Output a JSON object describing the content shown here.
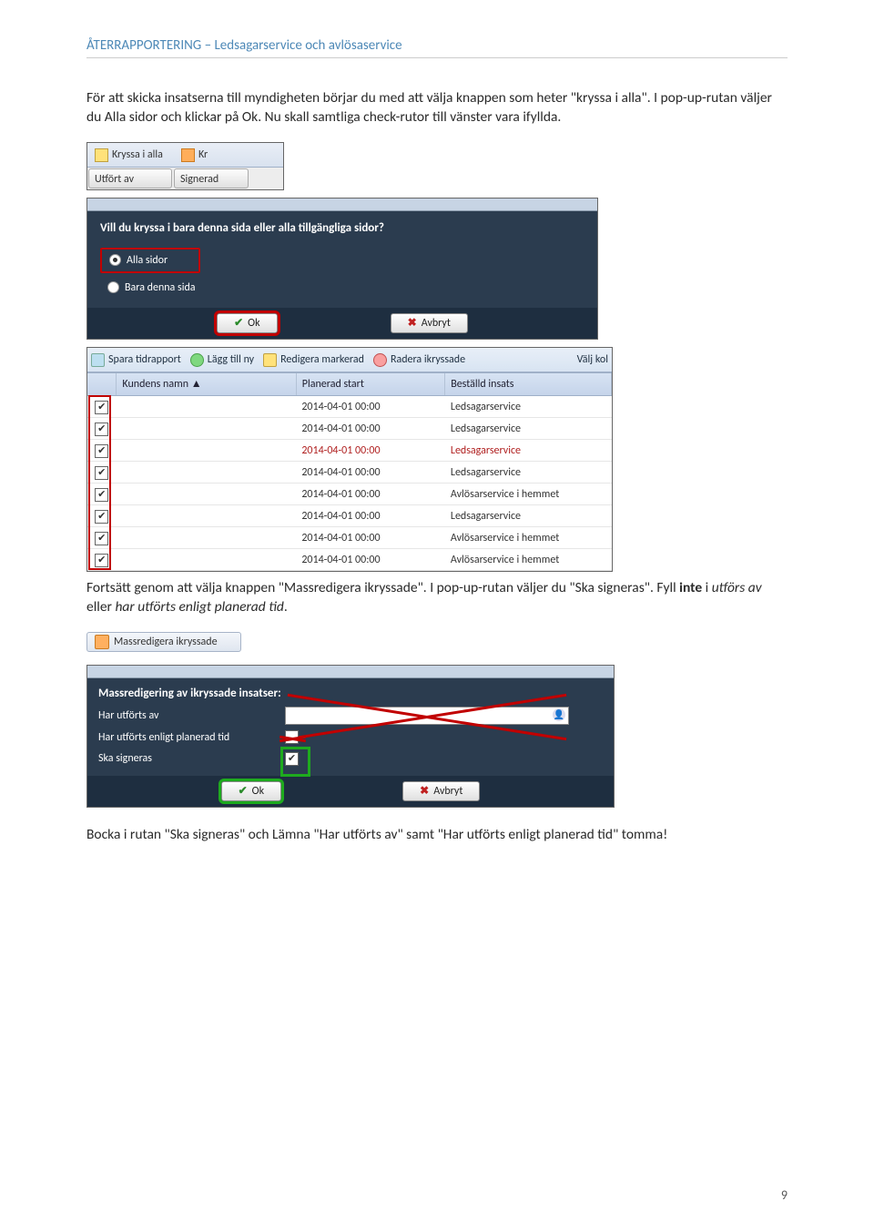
{
  "header": "ÅTERRAPPORTERING – Ledsagarservice och avlösaservice",
  "para1": "För att skicka insatserna till myndigheten börjar du med att välja knappen som heter \"kryssa i alla\". I pop-up-rutan väljer du Alla sidor och klickar på Ok. Nu skall samtliga check-rutor till vänster vara ifyllda.",
  "ss1": {
    "kryssa": "Kryssa i alla",
    "kr": "Kr",
    "utfort": "Utfört av",
    "signerad": "Signerad"
  },
  "dlg": {
    "q": "Vill du kryssa i bara denna sida eller alla tillgängliga sidor?",
    "r1": "Alla sidor",
    "r2": "Bara denna sida",
    "ok": "Ok",
    "cancel": "Avbryt"
  },
  "tbl": {
    "b1": "Spara tidrapport",
    "b2": "Lägg till ny",
    "b3": "Redigera markerad",
    "b4": "Radera ikryssade",
    "b5": "Välj kol",
    "h1": "Kundens namn",
    "h2": "Planerad start",
    "h3": "Beställd insats",
    "rows": [
      {
        "t": "2014-04-01 00:00",
        "i": "Ledsagarservice",
        "red": false
      },
      {
        "t": "2014-04-01 00:00",
        "i": "Ledsagarservice",
        "red": false
      },
      {
        "t": "2014-04-01 00:00",
        "i": "Ledsagarservice",
        "red": true
      },
      {
        "t": "2014-04-01 00:00",
        "i": "Ledsagarservice",
        "red": false
      },
      {
        "t": "2014-04-01 00:00",
        "i": "Avlösarservice i hemmet",
        "red": false
      },
      {
        "t": "2014-04-01 00:00",
        "i": "Ledsagarservice",
        "red": false
      },
      {
        "t": "2014-04-01 00:00",
        "i": "Avlösarservice i hemmet",
        "red": false
      },
      {
        "t": "2014-04-01 00:00",
        "i": "Avlösarservice i hemmet",
        "red": false
      }
    ]
  },
  "para2a": "Fortsätt genom att välja knappen \"Massredigera ikryssade\". I pop-up-rutan väljer du \"Ska signeras\". Fyll ",
  "para2b": "inte",
  "para2c": " i ",
  "para2d": "utförs av",
  "para2e": " eller ",
  "para2f": "har utförts enligt planerad tid",
  "para2g": ".",
  "massbtn": "Massredigera ikryssade",
  "mdlg": {
    "title": "Massredigering av ikryssade insatser:",
    "r1": "Har utförts av",
    "r2": "Har utförts enligt planerad tid",
    "r3": "Ska signeras",
    "ok": "Ok",
    "cancel": "Avbryt"
  },
  "para3": "Bocka i rutan \"Ska signeras\" och Lämna \"Har utförts av\" samt \"Har utförts enligt planerad tid\" tomma!",
  "pagenum": "9"
}
